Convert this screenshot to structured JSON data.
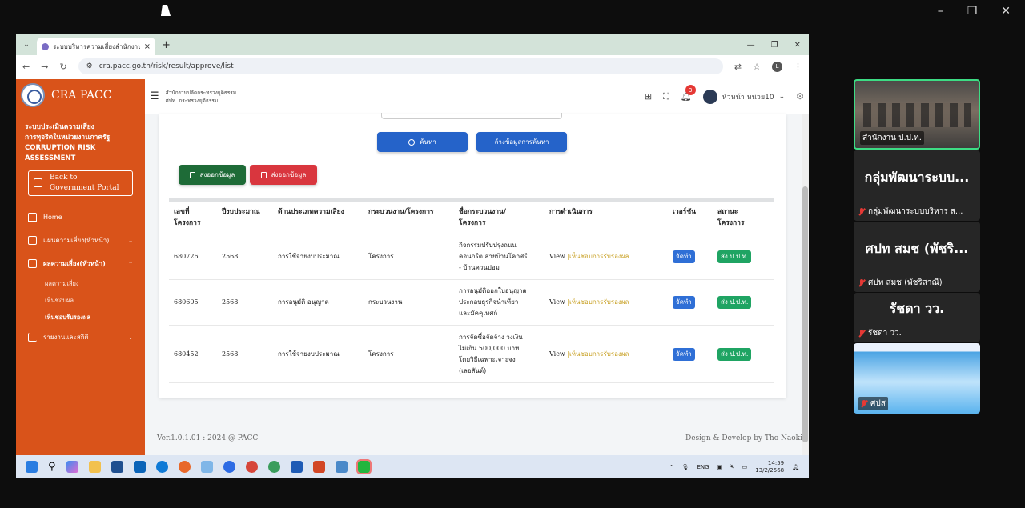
{
  "host": {
    "controls": [
      "–",
      "❐",
      "✕"
    ]
  },
  "browser": {
    "tab_title": "ระบบบริหารความเสี่ยงสำนักงาน ป.ป.ท.",
    "url": "cra.pacc.go.th/risk/result/approve/list",
    "profile_initial": "L"
  },
  "sidebar": {
    "brand": "CRA PACC",
    "system_title": [
      "ระบบประเมินความเสี่ยง",
      "การทุจริตในหน่วยงานภาครัฐ",
      "CORRUPTION RISK",
      "ASSESSMENT"
    ],
    "back_label": [
      "Back to",
      "Government Portal"
    ],
    "menu": [
      {
        "label": "Home"
      },
      {
        "label": "แผนความเสี่ยง(หัวหน้า)"
      },
      {
        "label": "ผลความเสี่ยง(หัวหน้า)"
      }
    ],
    "submenu": [
      "ผลความเสี่ยง",
      "เห็นชอบผล",
      "เห็นชอบรับรองผล"
    ],
    "menu_last": "รายงานและสถิติ"
  },
  "topnav": {
    "org_line1": "สำนักงานปลัดกระทรวงยุติธรรม",
    "org_line2": "ศปท. กระทรวงยุติธรรม",
    "notification_count": "3",
    "user_name": "หัวหน้า หน่วย10"
  },
  "actions": {
    "search": "ค้นหา",
    "clear": "ล้างข้อมูลการค้นหา",
    "export1": "ส่งออกข้อมูล",
    "export2": "ส่งออกข้อมูล"
  },
  "table": {
    "headers": [
      [
        "เลขที่",
        "โครงการ"
      ],
      [
        "ปีงบประมาณ"
      ],
      [
        "ด้านประเภทความเสี่ยง"
      ],
      [
        "กระบวนงาน/โครงการ"
      ],
      [
        "ชื่อกระบวนงาน/",
        "โครงการ"
      ],
      [
        "การดำเนินการ"
      ],
      [
        "เวอร์ชัน"
      ],
      [
        "สถานะ",
        "โครงการ"
      ]
    ],
    "rows": [
      {
        "no": "680726",
        "year": "2568",
        "risk_type": "การใช้จ่ายงบประมาณ",
        "kind": "โครงการ",
        "name": [
          "กิจกรรมปรับปรุงถนน",
          "คอนกรีต สายบ้านโคกศรี",
          "- บ้านควนปอม"
        ],
        "view": "View",
        "approve": "|เห็นชอบการรับรองผล",
        "version": "จัดทำ",
        "status": "ส่ง ป.ป.ท."
      },
      {
        "no": "680605",
        "year": "2568",
        "risk_type": "การอนุมัติ อนุญาต",
        "kind": "กระบวนงาน",
        "name": [
          "การอนุมัติออกใบอนุญาต",
          "ประกอบธุรกิจนำเที่ยว",
          "และมัคคุเทศก์"
        ],
        "view": "View",
        "approve": "|เห็นชอบการรับรองผล",
        "version": "จัดทำ",
        "status": "ส่ง ป.ป.ท."
      },
      {
        "no": "680452",
        "year": "2568",
        "risk_type": "การใช้จ่ายงบประมาณ",
        "kind": "โครงการ",
        "name": [
          "การจัดซื้อจัดจ้าง วงเงิน",
          "ไม่เกิน 500,000 บาท",
          "โดยวิธีเฉพาะเจาะจง",
          "(เลอสันต์)"
        ],
        "view": "View",
        "approve": "|เห็นชอบการรับรองผล",
        "version": "จัดทำ",
        "status": "ส่ง ป.ป.ท."
      }
    ]
  },
  "footer": {
    "version": "Ver.1.0.1.01 : 2024 @ PACC",
    "credit": "Design & Develop by Tho Naoki"
  },
  "taskbar": {
    "lang": "ENG",
    "time": "14:59",
    "date": "13/2/2568"
  },
  "participants": [
    {
      "name": "สำนักงาน ป.ป.ท.",
      "type": "video"
    },
    {
      "big": "กลุ่มพัฒนาระบบ...",
      "name": "กลุ่มพัฒนาระบบบริหาร ส...",
      "type": "name"
    },
    {
      "big": "ศปท สมช  (พัชริ...",
      "name": "ศปท สมช  (พัชริสาณี)",
      "type": "name"
    },
    {
      "big": "รัชดา วว.",
      "name": "รัชดา วว.",
      "type": "name"
    },
    {
      "name": "ศปส",
      "type": "screen"
    }
  ],
  "colors": {
    "sidebar": "#d9531a",
    "primary": "#2563c9",
    "export_green": "#1e6b37",
    "export_red": "#d9363e",
    "status_green": "#1fa463"
  }
}
